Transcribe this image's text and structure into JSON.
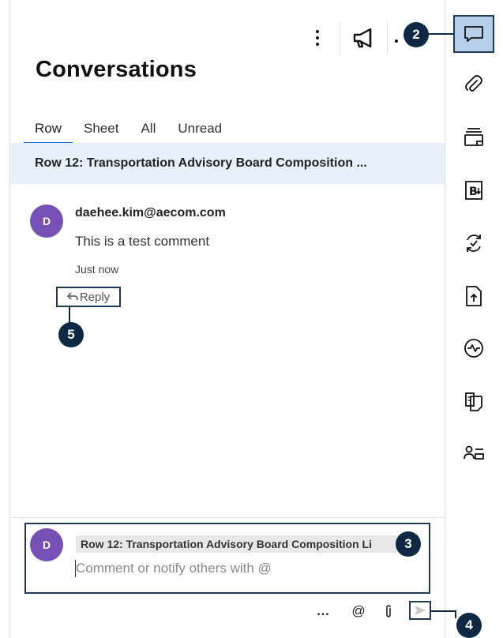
{
  "panel": {
    "title": "Conversations",
    "tabs": [
      {
        "label": "Row",
        "active": true
      },
      {
        "label": "Sheet",
        "active": false
      },
      {
        "label": "All",
        "active": false
      },
      {
        "label": "Unread",
        "active": false
      }
    ],
    "row_banner": "Row 12: Transportation Advisory Board Composition ..."
  },
  "comment": {
    "avatar_initial": "D",
    "author": "daehee.kim@aecom.com",
    "body": "This is a test comment",
    "time": "Just now",
    "reply_label": "Reply"
  },
  "composer": {
    "avatar_initial": "D",
    "row_tag": "Row 12: Transportation Advisory Board Composition Li",
    "placeholder": "Comment or notify others with @",
    "tools": {
      "more": "…",
      "mention": "@"
    }
  },
  "callouts": [
    "2",
    "3",
    "4",
    "5"
  ],
  "sidebar": {
    "items": [
      {
        "icon": "comment-icon",
        "active": true
      },
      {
        "icon": "paperclip-icon",
        "active": false
      },
      {
        "icon": "layers-icon",
        "active": false
      },
      {
        "icon": "brandfolder-icon",
        "active": false
      },
      {
        "icon": "update-requests-icon",
        "active": false
      },
      {
        "icon": "file-upload-icon",
        "active": false
      },
      {
        "icon": "activity-icon",
        "active": false
      },
      {
        "icon": "proofs-icon",
        "active": false
      },
      {
        "icon": "summary-icon",
        "active": false
      }
    ]
  },
  "colors": {
    "accent": "#1d72d1",
    "avatar": "#7551b5",
    "banner": "#e6f0fb",
    "callout": "#0f2944",
    "sidebar_active": "#b7cfe9"
  }
}
